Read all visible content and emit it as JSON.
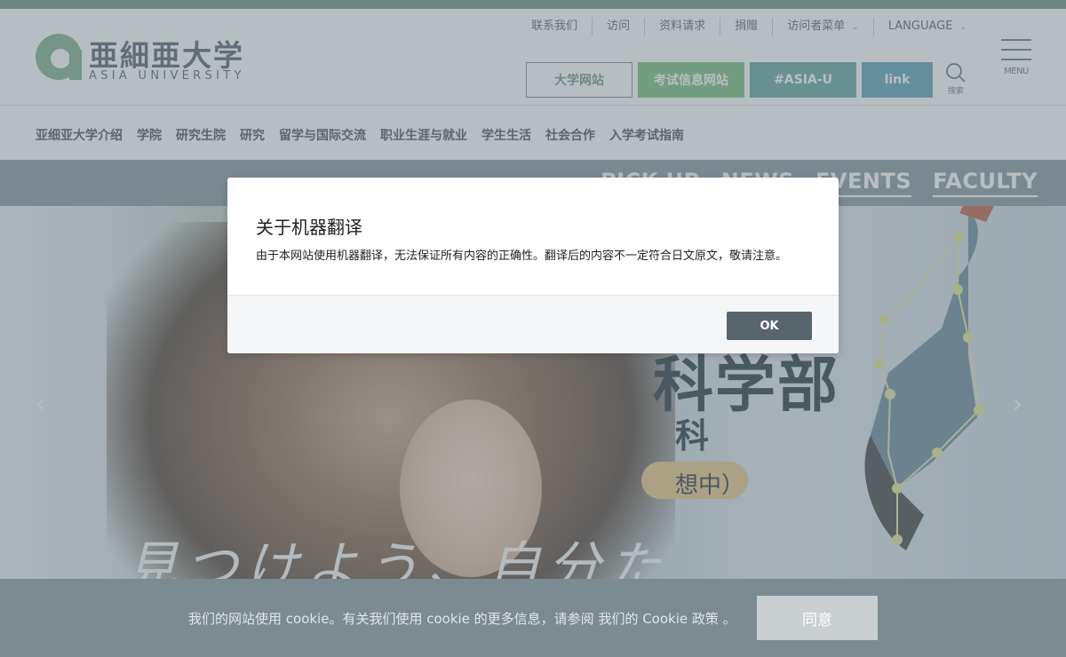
{
  "logo": {
    "jp": "亜細亜大学",
    "en": "ASIA UNIVERSITY"
  },
  "util_nav": [
    {
      "label": "联系我们",
      "dropdown": false
    },
    {
      "label": "访问",
      "dropdown": false
    },
    {
      "label": "资料请求",
      "dropdown": false
    },
    {
      "label": "捐赠",
      "dropdown": false
    },
    {
      "label": "访问者菜单",
      "dropdown": true
    },
    {
      "label": "LANGUAGE",
      "dropdown": true
    }
  ],
  "header_buttons": [
    "大学网站",
    "考试信息网站",
    "#ASIA-U",
    "link"
  ],
  "search": {
    "icon": "search-icon",
    "label": "搜索"
  },
  "menu": {
    "icon": "hamburger-icon",
    "label": "MENU"
  },
  "main_nav": [
    "亚细亚大学介绍",
    "学院",
    "研究生院",
    "研究",
    "留学与国际交流",
    "职业生涯与就业",
    "学生生活",
    "社会合作",
    "入学考试指南"
  ],
  "hero": {
    "tabs": [
      "PICK UP",
      "NEWS",
      "EVENTS",
      "FACULTY"
    ],
    "headline": "科学部",
    "subhead": "科",
    "pill": "想中）",
    "handwriting": "見つけよう、自分た"
  },
  "modal": {
    "title": "关于机器翻译",
    "body": "由于本网站使用机器翻译，无法保证所有内容的正确性。翻译后的内容不一定符合日文原文，敬请注意。",
    "ok": "OK"
  },
  "cookie": {
    "text": "我们的网站使用 cookie。有关我们使用 cookie 的更多信息，请参阅 我们的 Cookie 政策 。",
    "agree": "同意"
  },
  "colors": {
    "brand_green": "#6e9a82",
    "overlay": "rgba(105,120,128,0.48)",
    "ok_button": "#58656d"
  }
}
